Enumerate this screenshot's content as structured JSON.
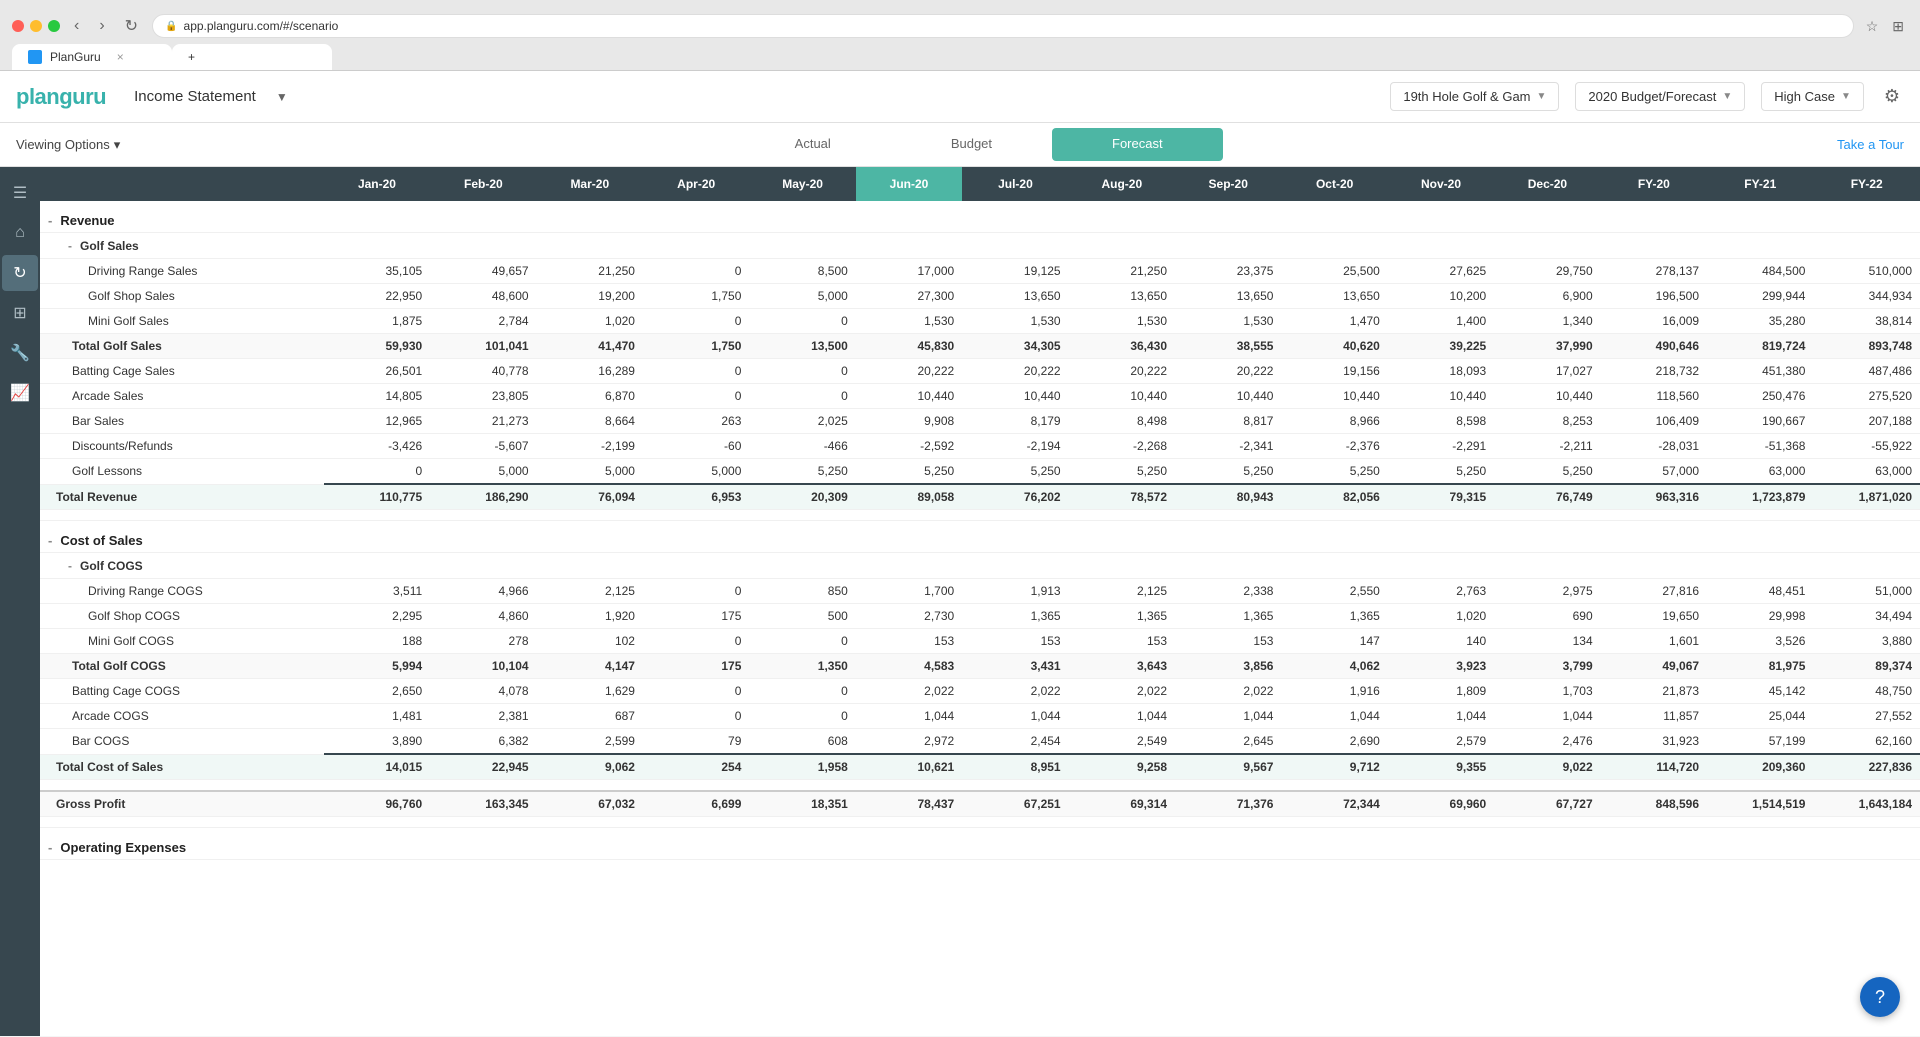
{
  "browser": {
    "tab_title": "PlanGuru",
    "url": "app.planguru.com/#/scenario",
    "tab_close": "×"
  },
  "nav": {
    "logo_plan": "plan",
    "logo_guru": "guru",
    "income_statement": "Income Statement",
    "company": "19th Hole Golf & Gam",
    "period": "2020 Budget/Forecast",
    "scenario": "High Case",
    "settings_icon": "⚙"
  },
  "sub_nav": {
    "viewing_options": "Viewing Options",
    "tab_actual": "Actual",
    "tab_budget": "Budget",
    "tab_forecast": "Forecast",
    "tour_link": "Take a Tour"
  },
  "columns": [
    "Jan-20",
    "Feb-20",
    "Mar-20",
    "Apr-20",
    "May-20",
    "Jun-20",
    "Jul-20",
    "Aug-20",
    "Sep-20",
    "Oct-20",
    "Nov-20",
    "Dec-20",
    "FY-20",
    "FY-21",
    "FY-22"
  ],
  "sections": {
    "revenue": {
      "label": "Revenue",
      "golf_sales": {
        "label": "Golf Sales",
        "rows": [
          {
            "label": "Driving Range Sales",
            "vals": [
              "35,105",
              "49,657",
              "21,250",
              "0",
              "8,500",
              "17,000",
              "19,125",
              "21,250",
              "23,375",
              "25,500",
              "27,625",
              "29,750",
              "278,137",
              "484,500",
              "510,000"
            ]
          },
          {
            "label": "Golf Shop Sales",
            "vals": [
              "22,950",
              "48,600",
              "19,200",
              "1,750",
              "5,000",
              "27,300",
              "13,650",
              "13,650",
              "13,650",
              "13,650",
              "10,200",
              "6,900",
              "196,500",
              "299,944",
              "344,934"
            ]
          },
          {
            "label": "Mini Golf Sales",
            "vals": [
              "1,875",
              "2,784",
              "1,020",
              "0",
              "0",
              "1,530",
              "1,530",
              "1,530",
              "1,530",
              "1,470",
              "1,400",
              "1,340",
              "16,009",
              "35,280",
              "38,814"
            ]
          }
        ],
        "total": {
          "label": "Total Golf Sales",
          "vals": [
            "59,930",
            "101,041",
            "41,470",
            "1,750",
            "13,500",
            "45,830",
            "34,305",
            "36,430",
            "38,555",
            "40,620",
            "39,225",
            "37,990",
            "490,646",
            "819,724",
            "893,748"
          ]
        }
      },
      "other_rows": [
        {
          "label": "Batting Cage Sales",
          "vals": [
            "26,501",
            "40,778",
            "16,289",
            "0",
            "0",
            "20,222",
            "20,222",
            "20,222",
            "20,222",
            "19,156",
            "18,093",
            "17,027",
            "218,732",
            "451,380",
            "487,486"
          ]
        },
        {
          "label": "Arcade Sales",
          "vals": [
            "14,805",
            "23,805",
            "6,870",
            "0",
            "0",
            "10,440",
            "10,440",
            "10,440",
            "10,440",
            "10,440",
            "10,440",
            "10,440",
            "118,560",
            "250,476",
            "275,520"
          ]
        },
        {
          "label": "Bar Sales",
          "vals": [
            "12,965",
            "21,273",
            "8,664",
            "263",
            "2,025",
            "9,908",
            "8,179",
            "8,498",
            "8,817",
            "8,966",
            "8,598",
            "8,253",
            "106,409",
            "190,667",
            "207,188"
          ]
        },
        {
          "label": "Discounts/Refunds",
          "vals": [
            "-3,426",
            "-5,607",
            "-2,199",
            "-60",
            "-466",
            "-2,592",
            "-2,194",
            "-2,268",
            "-2,341",
            "-2,376",
            "-2,291",
            "-2,211",
            "-28,031",
            "-51,368",
            "-55,922"
          ]
        },
        {
          "label": "Golf Lessons",
          "vals": [
            "0",
            "5,000",
            "5,000",
            "5,000",
            "5,250",
            "5,250",
            "5,250",
            "5,250",
            "5,250",
            "5,250",
            "5,250",
            "5,250",
            "57,000",
            "63,000",
            "63,000"
          ]
        }
      ],
      "total": {
        "label": "Total Revenue",
        "vals": [
          "110,775",
          "186,290",
          "76,094",
          "6,953",
          "20,309",
          "89,058",
          "76,202",
          "78,572",
          "80,943",
          "82,056",
          "79,315",
          "76,749",
          "963,316",
          "1,723,879",
          "1,871,020"
        ]
      }
    },
    "cost_of_sales": {
      "label": "Cost of Sales",
      "golf_cogs": {
        "label": "Golf COGS",
        "rows": [
          {
            "label": "Driving Range COGS",
            "vals": [
              "3,511",
              "4,966",
              "2,125",
              "0",
              "850",
              "1,700",
              "1,913",
              "2,125",
              "2,338",
              "2,550",
              "2,763",
              "2,975",
              "27,816",
              "48,451",
              "51,000"
            ]
          },
          {
            "label": "Golf Shop COGS",
            "vals": [
              "2,295",
              "4,860",
              "1,920",
              "175",
              "500",
              "2,730",
              "1,365",
              "1,365",
              "1,365",
              "1,365",
              "1,020",
              "690",
              "19,650",
              "29,998",
              "34,494"
            ]
          },
          {
            "label": "Mini Golf COGS",
            "vals": [
              "188",
              "278",
              "102",
              "0",
              "0",
              "153",
              "153",
              "153",
              "153",
              "147",
              "140",
              "134",
              "1,601",
              "3,526",
              "3,880"
            ]
          }
        ],
        "total": {
          "label": "Total Golf COGS",
          "vals": [
            "5,994",
            "10,104",
            "4,147",
            "175",
            "1,350",
            "4,583",
            "3,431",
            "3,643",
            "3,856",
            "4,062",
            "3,923",
            "3,799",
            "49,067",
            "81,975",
            "89,374"
          ]
        }
      },
      "other_rows": [
        {
          "label": "Batting Cage COGS",
          "vals": [
            "2,650",
            "4,078",
            "1,629",
            "0",
            "0",
            "2,022",
            "2,022",
            "2,022",
            "2,022",
            "1,916",
            "1,809",
            "1,703",
            "21,873",
            "45,142",
            "48,750"
          ]
        },
        {
          "label": "Arcade COGS",
          "vals": [
            "1,481",
            "2,381",
            "687",
            "0",
            "0",
            "1,044",
            "1,044",
            "1,044",
            "1,044",
            "1,044",
            "1,044",
            "1,044",
            "11,857",
            "25,044",
            "27,552"
          ]
        },
        {
          "label": "Bar COGS",
          "vals": [
            "3,890",
            "6,382",
            "2,599",
            "79",
            "608",
            "2,972",
            "2,454",
            "2,549",
            "2,645",
            "2,690",
            "2,579",
            "2,476",
            "31,923",
            "57,199",
            "62,160"
          ]
        }
      ],
      "total": {
        "label": "Total Cost of Sales",
        "vals": [
          "14,015",
          "22,945",
          "9,062",
          "254",
          "1,958",
          "10,621",
          "8,951",
          "9,258",
          "9,567",
          "9,712",
          "9,355",
          "9,022",
          "114,720",
          "209,360",
          "227,836"
        ]
      }
    },
    "gross_profit": {
      "label": "Gross Profit",
      "vals": [
        "96,760",
        "163,345",
        "67,032",
        "6,699",
        "18,351",
        "78,437",
        "67,251",
        "69,314",
        "71,376",
        "72,344",
        "69,960",
        "67,727",
        "848,596",
        "1,514,519",
        "1,643,184"
      ]
    },
    "operating_expenses": {
      "label": "Operating Expenses"
    }
  }
}
